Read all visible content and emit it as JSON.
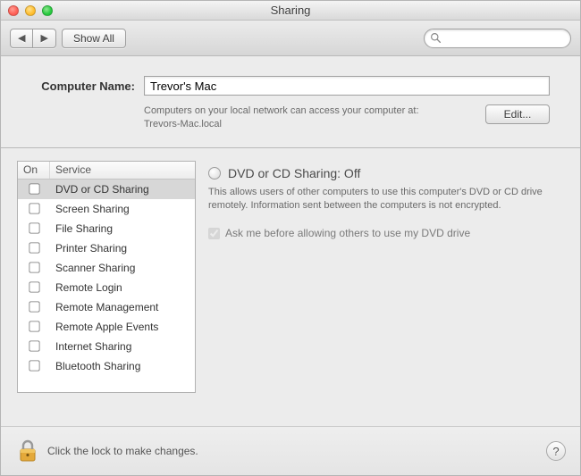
{
  "window": {
    "title": "Sharing"
  },
  "toolbar": {
    "show_all_label": "Show All",
    "search_placeholder": ""
  },
  "computer_name": {
    "label": "Computer Name:",
    "value": "Trevor's Mac",
    "subtext_line1": "Computers on your local network can access your computer at:",
    "subtext_line2": "Trevors-Mac.local",
    "edit_label": "Edit..."
  },
  "services": {
    "header_on": "On",
    "header_service": "Service",
    "items": [
      {
        "label": "DVD or CD Sharing",
        "checked": false,
        "selected": true
      },
      {
        "label": "Screen Sharing",
        "checked": false,
        "selected": false
      },
      {
        "label": "File Sharing",
        "checked": false,
        "selected": false
      },
      {
        "label": "Printer Sharing",
        "checked": false,
        "selected": false
      },
      {
        "label": "Scanner Sharing",
        "checked": false,
        "selected": false
      },
      {
        "label": "Remote Login",
        "checked": false,
        "selected": false
      },
      {
        "label": "Remote Management",
        "checked": false,
        "selected": false
      },
      {
        "label": "Remote Apple Events",
        "checked": false,
        "selected": false
      },
      {
        "label": "Internet Sharing",
        "checked": false,
        "selected": false
      },
      {
        "label": "Bluetooth Sharing",
        "checked": false,
        "selected": false
      }
    ]
  },
  "detail": {
    "title": "DVD or CD Sharing: Off",
    "description": "This allows users of other computers to use this computer's DVD or CD drive remotely. Information sent between the computers is not encrypted.",
    "ask_label": "Ask me before allowing others to use my DVD drive",
    "ask_checked": true
  },
  "footer": {
    "text": "Click the lock to make changes.",
    "help": "?"
  }
}
